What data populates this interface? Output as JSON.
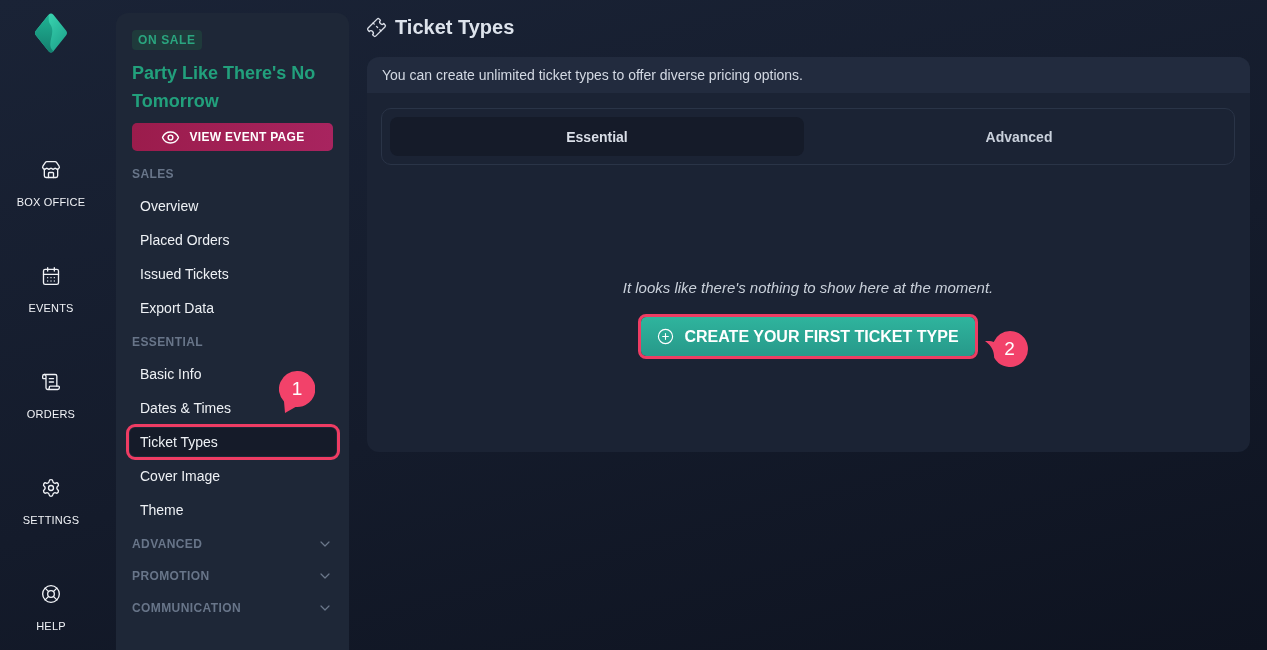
{
  "rail": {
    "items": [
      {
        "label": "BOX OFFICE"
      },
      {
        "label": "EVENTS"
      },
      {
        "label": "ORDERS"
      },
      {
        "label": "SETTINGS"
      },
      {
        "label": "HELP"
      }
    ]
  },
  "event": {
    "status": "ON SALE",
    "title": "Party Like There's No Tomorrow",
    "view_button": "VIEW EVENT PAGE"
  },
  "sidebar": {
    "sections": [
      {
        "kind": "list",
        "heading": "SALES",
        "items": [
          {
            "label": "Overview",
            "selected": false,
            "highlighted": false
          },
          {
            "label": "Placed Orders",
            "selected": false,
            "highlighted": false
          },
          {
            "label": "Issued Tickets",
            "selected": false,
            "highlighted": false
          },
          {
            "label": "Export Data",
            "selected": false,
            "highlighted": false
          }
        ]
      },
      {
        "kind": "list",
        "heading": "ESSENTIAL",
        "items": [
          {
            "label": "Basic Info",
            "selected": false,
            "highlighted": false
          },
          {
            "label": "Dates & Times",
            "selected": false,
            "highlighted": false
          },
          {
            "label": "Ticket Types",
            "selected": true,
            "highlighted": true,
            "callout": "1"
          },
          {
            "label": "Cover Image",
            "selected": false,
            "highlighted": false
          },
          {
            "label": "Theme",
            "selected": false,
            "highlighted": false
          }
        ]
      },
      {
        "kind": "collapsible",
        "heading": "ADVANCED",
        "expanded": false
      },
      {
        "kind": "collapsible",
        "heading": "PROMOTION",
        "expanded": false
      },
      {
        "kind": "collapsible",
        "heading": "COMMUNICATION",
        "expanded": false
      }
    ]
  },
  "page": {
    "title": "Ticket Types"
  },
  "card": {
    "note": "You can create unlimited ticket types to offer diverse pricing options.",
    "tabs": [
      {
        "label": "Essential",
        "selected": true
      },
      {
        "label": "Advanced",
        "selected": false
      }
    ],
    "empty_message": "It looks like there's nothing to show here at the moment.",
    "create_button": {
      "label": "CREATE YOUR FIRST TICKET TYPE",
      "highlighted": true,
      "callout": "2"
    }
  }
}
